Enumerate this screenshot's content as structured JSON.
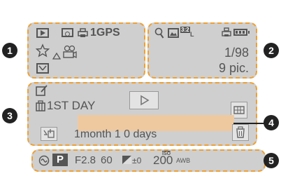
{
  "markers": {
    "m1": "1",
    "m2": "2",
    "m3": "3",
    "m4": "4",
    "m5": "5"
  },
  "area1": {
    "print_gps_label": "1GPS"
  },
  "area2": {
    "aspect_label": "3:2",
    "size_label": "L",
    "frame_counter": "1/98",
    "pic_count": "9 pic."
  },
  "area3": {
    "travel_day_label": "1ST DAY",
    "age_label": "1month  1 0 days"
  },
  "area5": {
    "mode_label": "P",
    "aperture": "F2.8",
    "shutter": "60",
    "ev_value": "±0",
    "iso_value": "200",
    "iso_label": "ISO",
    "wb_label": "AWB"
  },
  "colors": {
    "panel": "#cfcfcf",
    "dash": "#f0a030",
    "title_bar": "#eec9a0",
    "marker": "#222222"
  }
}
